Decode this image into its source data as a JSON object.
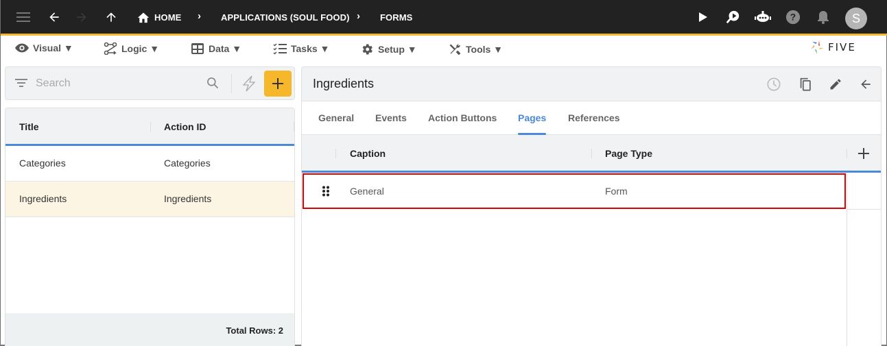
{
  "topbar": {
    "breadcrumbs": [
      "HOME",
      "APPLICATIONS (SOUL FOOD)",
      "FORMS"
    ],
    "icons": [
      "menu-icon",
      "back-arrow-icon",
      "forward-arrow-icon",
      "up-arrow-icon",
      "home-icon",
      "play-icon",
      "search-play-icon",
      "chatbot-icon",
      "help-icon",
      "bell-icon"
    ],
    "avatar_letter": "S"
  },
  "menubar": {
    "items": [
      {
        "label": "Visual ▼",
        "icon": "eye-icon"
      },
      {
        "label": "Logic ▼",
        "icon": "logic-icon"
      },
      {
        "label": "Data ▼",
        "icon": "table-icon"
      },
      {
        "label": "Tasks ▼",
        "icon": "tasks-icon"
      },
      {
        "label": "Setup ▼",
        "icon": "gear-icon"
      },
      {
        "label": "Tools ▼",
        "icon": "tools-icon"
      }
    ],
    "logo_text": "FIVE"
  },
  "left_panel": {
    "search": {
      "placeholder": "Search",
      "value": ""
    },
    "columns": [
      "Title",
      "Action ID"
    ],
    "rows": [
      {
        "title": "Categories",
        "action_id": "Categories",
        "selected": false
      },
      {
        "title": "Ingredients",
        "action_id": "Ingredients",
        "selected": true
      }
    ],
    "total_rows": "Total Rows: 2"
  },
  "detail": {
    "title": "Ingredients",
    "tabs": [
      {
        "label": "General",
        "active": false
      },
      {
        "label": "Events",
        "active": false
      },
      {
        "label": "Action Buttons",
        "active": false
      },
      {
        "label": "Pages",
        "active": true
      },
      {
        "label": "References",
        "active": false
      }
    ],
    "columns": [
      "Caption",
      "Page Type"
    ],
    "rows": [
      {
        "caption": "General",
        "page_type": "Form"
      }
    ]
  },
  "colors": {
    "accent_yellow": "#f6b72a",
    "accent_blue": "#4a88d8",
    "highlight_red": "#e00000",
    "selected_row": "#fdf5e4"
  }
}
